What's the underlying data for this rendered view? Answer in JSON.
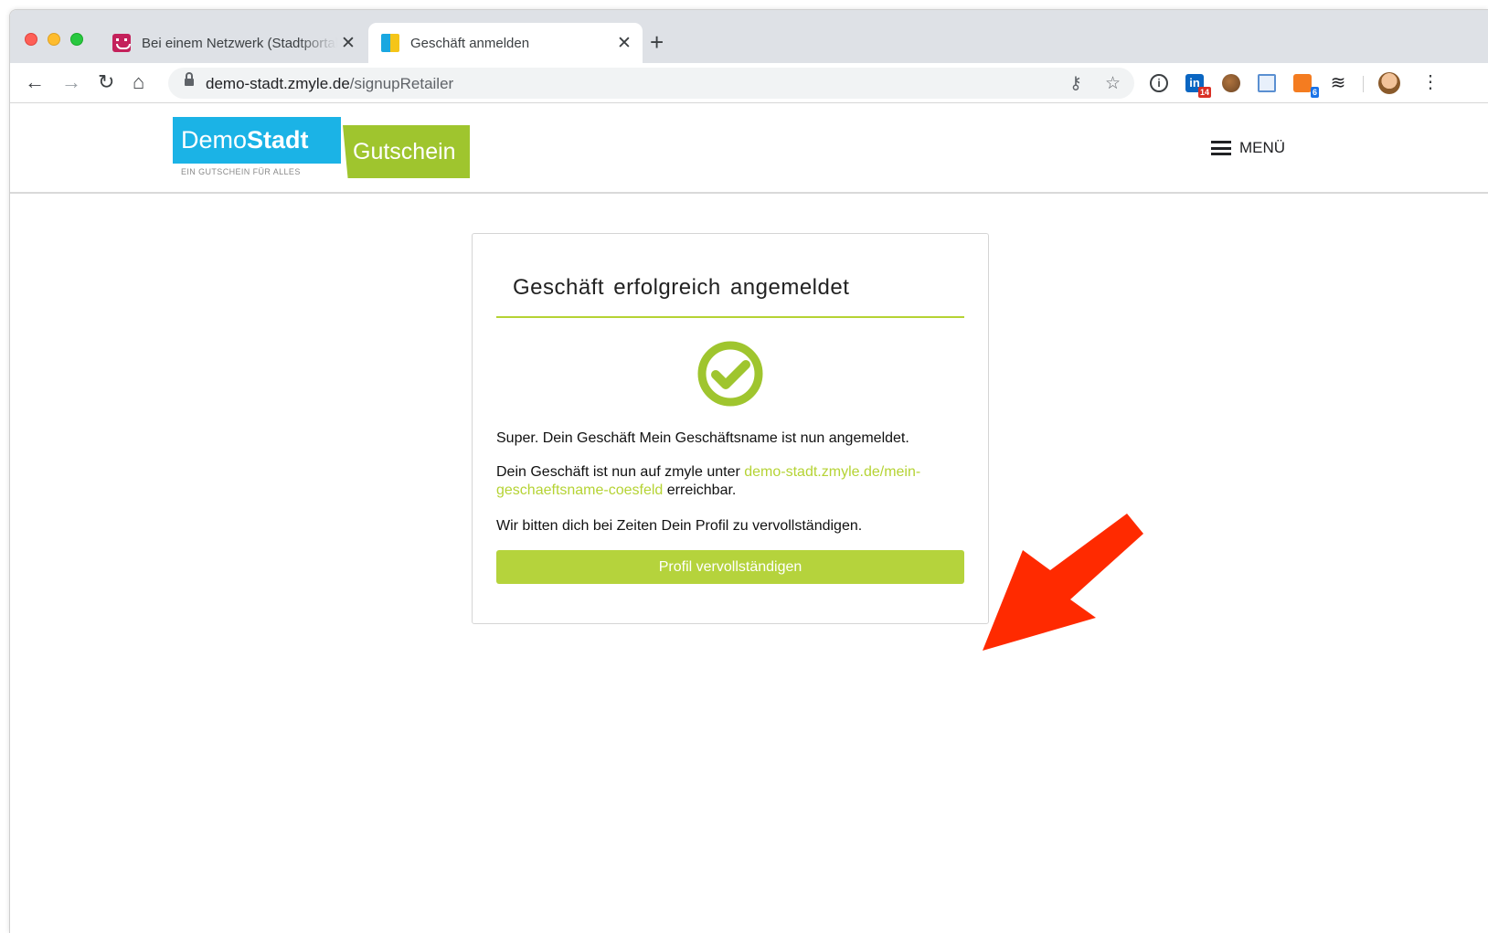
{
  "browser": {
    "tabs": [
      {
        "title": "Bei einem Netzwerk (Stadtportal",
        "close": "✕"
      },
      {
        "title": "Geschäft anmelden",
        "close": "✕"
      }
    ],
    "new_tab": "+",
    "url_host": "demo-stadt.zmyle.de",
    "url_path": "/signupRetailer",
    "extension_badges": {
      "linkedin": "14",
      "hub": "6"
    },
    "icons": [
      "back-icon",
      "forward-icon",
      "reload-icon",
      "home-icon",
      "lock-icon",
      "key-icon",
      "star-icon",
      "info-icon",
      "linkedin-icon",
      "cookie-icon",
      "window-icon",
      "hub-icon",
      "stack-icon",
      "avatar",
      "kebab-icon"
    ]
  },
  "site": {
    "logo": {
      "demo": "Demo",
      "stadt": "Stadt",
      "gutschein": "Gutschein",
      "tagline": "EIN GUTSCHEIN FÜR ALLES"
    },
    "menu_label": "MENÜ"
  },
  "card": {
    "title": "Geschäft erfolgreich angemeldet",
    "message1": "Super. Dein Geschäft Mein Geschäftsname ist nun angemeldet.",
    "message2_prefix": "Dein Geschäft ist nun auf zmyle unter ",
    "message2_link": "demo-stadt.zmyle.de/mein-geschaeftsname-coesfeld",
    "message2_suffix": " erreichbar.",
    "message3": "Wir bitten dich bei Zeiten Dein Profil zu vervollständigen.",
    "button": "Profil vervollständigen"
  },
  "colors": {
    "accent_green": "#b5d334",
    "logo_blue": "#1bb3e6",
    "annotation_arrow": "#ff2a00"
  }
}
